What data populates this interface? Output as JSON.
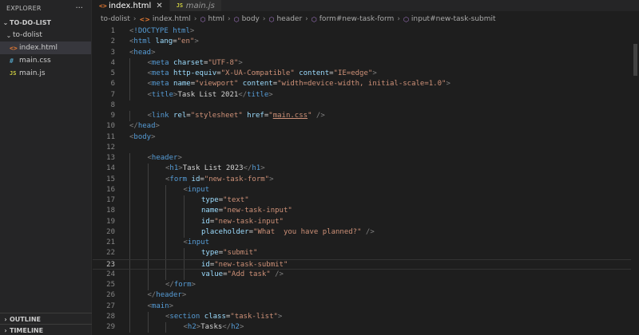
{
  "sidebar": {
    "title": "EXPLORER",
    "more": "···",
    "project": "TO-DO-LIST",
    "folder": "to-dolist",
    "files": [
      {
        "name": "index.html",
        "icon": "<>",
        "type": "html"
      },
      {
        "name": "main.css",
        "icon": "#",
        "type": "css"
      },
      {
        "name": "main.js",
        "icon": "JS",
        "type": "js"
      }
    ],
    "outline": "OUTLINE",
    "timeline": "TIMELINE"
  },
  "tabs": [
    {
      "label": "index.html",
      "icon": "<>",
      "close": "✕"
    },
    {
      "label": "main.js",
      "icon": "JS"
    }
  ],
  "breadcrumb": [
    "to-dolist",
    "index.html",
    "html",
    "body",
    "header",
    "form#new-task-form",
    "input#new-task-submit"
  ],
  "editor": {
    "current_line": "23",
    "lines": [
      {
        "n": "1",
        "indent": 0,
        "tokens": [
          [
            "br",
            "<"
          ],
          [
            "tag",
            "!DOCTYPE"
          ],
          [
            "txt",
            " "
          ],
          [
            "tag",
            "html"
          ],
          [
            "br",
            ">"
          ]
        ]
      },
      {
        "n": "2",
        "indent": 0,
        "tokens": [
          [
            "br",
            "<"
          ],
          [
            "tag",
            "html"
          ],
          [
            "txt",
            " "
          ],
          [
            "attr",
            "lang"
          ],
          [
            "txt",
            "="
          ],
          [
            "str",
            "\"en\""
          ],
          [
            "br",
            ">"
          ]
        ]
      },
      {
        "n": "3",
        "indent": 0,
        "tokens": [
          [
            "br",
            "<"
          ],
          [
            "tag",
            "head"
          ],
          [
            "br",
            ">"
          ]
        ]
      },
      {
        "n": "4",
        "indent": 1,
        "tokens": [
          [
            "br",
            "<"
          ],
          [
            "tag",
            "meta"
          ],
          [
            "txt",
            " "
          ],
          [
            "attr",
            "charset"
          ],
          [
            "txt",
            "="
          ],
          [
            "str",
            "\"UTF-8\""
          ],
          [
            "br",
            ">"
          ]
        ]
      },
      {
        "n": "5",
        "indent": 1,
        "tokens": [
          [
            "br",
            "<"
          ],
          [
            "tag",
            "meta"
          ],
          [
            "txt",
            " "
          ],
          [
            "attr",
            "http-equiv"
          ],
          [
            "txt",
            "="
          ],
          [
            "str",
            "\"X-UA-Compatible\""
          ],
          [
            "txt",
            " "
          ],
          [
            "attr",
            "content"
          ],
          [
            "txt",
            "="
          ],
          [
            "str",
            "\"IE=edge\""
          ],
          [
            "br",
            ">"
          ]
        ]
      },
      {
        "n": "6",
        "indent": 1,
        "tokens": [
          [
            "br",
            "<"
          ],
          [
            "tag",
            "meta"
          ],
          [
            "txt",
            " "
          ],
          [
            "attr",
            "name"
          ],
          [
            "txt",
            "="
          ],
          [
            "str",
            "\"viewport\""
          ],
          [
            "txt",
            " "
          ],
          [
            "attr",
            "content"
          ],
          [
            "txt",
            "="
          ],
          [
            "str",
            "\"width=device-width, initial-scale=1.0\""
          ],
          [
            "br",
            ">"
          ]
        ]
      },
      {
        "n": "7",
        "indent": 1,
        "tokens": [
          [
            "br",
            "<"
          ],
          [
            "tag",
            "title"
          ],
          [
            "br",
            ">"
          ],
          [
            "txt",
            "Task List 2021"
          ],
          [
            "br",
            "</"
          ],
          [
            "tag",
            "title"
          ],
          [
            "br",
            ">"
          ]
        ]
      },
      {
        "n": "8",
        "indent": 0,
        "tokens": []
      },
      {
        "n": "9",
        "indent": 1,
        "tokens": [
          [
            "br",
            "<"
          ],
          [
            "tag",
            "link"
          ],
          [
            "txt",
            " "
          ],
          [
            "attr",
            "rel"
          ],
          [
            "txt",
            "="
          ],
          [
            "str",
            "\"stylesheet\""
          ],
          [
            "txt",
            " "
          ],
          [
            "attr",
            "href"
          ],
          [
            "txt",
            "="
          ],
          [
            "str",
            "\""
          ],
          [
            "link",
            "main.css"
          ],
          [
            "str",
            "\""
          ],
          [
            "txt",
            " "
          ],
          [
            "br",
            "/>"
          ]
        ]
      },
      {
        "n": "10",
        "indent": 0,
        "tokens": [
          [
            "br",
            "</"
          ],
          [
            "tag",
            "head"
          ],
          [
            "br",
            ">"
          ]
        ]
      },
      {
        "n": "11",
        "indent": 0,
        "tokens": [
          [
            "br",
            "<"
          ],
          [
            "tag",
            "body"
          ],
          [
            "br",
            ">"
          ]
        ]
      },
      {
        "n": "12",
        "indent": 0,
        "tokens": []
      },
      {
        "n": "13",
        "indent": 1,
        "tokens": [
          [
            "br",
            "<"
          ],
          [
            "tag",
            "header"
          ],
          [
            "br",
            ">"
          ]
        ]
      },
      {
        "n": "14",
        "indent": 2,
        "tokens": [
          [
            "br",
            "<"
          ],
          [
            "tag",
            "h1"
          ],
          [
            "br",
            ">"
          ],
          [
            "txt",
            "Task List 2023"
          ],
          [
            "br",
            "</"
          ],
          [
            "tag",
            "h1"
          ],
          [
            "br",
            ">"
          ]
        ]
      },
      {
        "n": "15",
        "indent": 2,
        "tokens": [
          [
            "br",
            "<"
          ],
          [
            "tag",
            "form"
          ],
          [
            "txt",
            " "
          ],
          [
            "attr",
            "id"
          ],
          [
            "txt",
            "="
          ],
          [
            "str",
            "\"new-task-form\""
          ],
          [
            "br",
            ">"
          ]
        ]
      },
      {
        "n": "16",
        "indent": 3,
        "tokens": [
          [
            "br",
            "<"
          ],
          [
            "tag",
            "input"
          ]
        ]
      },
      {
        "n": "17",
        "indent": 4,
        "tokens": [
          [
            "attr",
            "type"
          ],
          [
            "txt",
            "="
          ],
          [
            "str",
            "\"text\""
          ]
        ]
      },
      {
        "n": "18",
        "indent": 4,
        "tokens": [
          [
            "attr",
            "name"
          ],
          [
            "txt",
            "="
          ],
          [
            "str",
            "\"new-task-input\""
          ]
        ]
      },
      {
        "n": "19",
        "indent": 4,
        "tokens": [
          [
            "attr",
            "id"
          ],
          [
            "txt",
            "="
          ],
          [
            "str",
            "\"new-task-input\""
          ]
        ]
      },
      {
        "n": "20",
        "indent": 4,
        "tokens": [
          [
            "attr",
            "placeholder"
          ],
          [
            "txt",
            "="
          ],
          [
            "str",
            "\"What  you have planned?\""
          ],
          [
            "txt",
            " "
          ],
          [
            "br",
            "/>"
          ]
        ]
      },
      {
        "n": "21",
        "indent": 3,
        "tokens": [
          [
            "br",
            "<"
          ],
          [
            "tag",
            "input"
          ]
        ]
      },
      {
        "n": "22",
        "indent": 4,
        "tokens": [
          [
            "attr",
            "type"
          ],
          [
            "txt",
            "="
          ],
          [
            "str",
            "\"submit\""
          ]
        ]
      },
      {
        "n": "23",
        "indent": 4,
        "tokens": [
          [
            "attr",
            "id"
          ],
          [
            "txt",
            "="
          ],
          [
            "str",
            "\"new-task-submit\""
          ]
        ]
      },
      {
        "n": "24",
        "indent": 4,
        "tokens": [
          [
            "attr",
            "value"
          ],
          [
            "txt",
            "="
          ],
          [
            "str",
            "\"Add task\""
          ],
          [
            "txt",
            " "
          ],
          [
            "br",
            "/>"
          ]
        ]
      },
      {
        "n": "25",
        "indent": 2,
        "tokens": [
          [
            "br",
            "</"
          ],
          [
            "tag",
            "form"
          ],
          [
            "br",
            ">"
          ]
        ]
      },
      {
        "n": "26",
        "indent": 1,
        "tokens": [
          [
            "br",
            "</"
          ],
          [
            "tag",
            "header"
          ],
          [
            "br",
            ">"
          ]
        ]
      },
      {
        "n": "27",
        "indent": 1,
        "tokens": [
          [
            "br",
            "<"
          ],
          [
            "tag",
            "main"
          ],
          [
            "br",
            ">"
          ]
        ]
      },
      {
        "n": "28",
        "indent": 2,
        "tokens": [
          [
            "br",
            "<"
          ],
          [
            "tag",
            "section"
          ],
          [
            "txt",
            " "
          ],
          [
            "attr",
            "class"
          ],
          [
            "txt",
            "="
          ],
          [
            "str",
            "\"task-list\""
          ],
          [
            "br",
            ">"
          ]
        ]
      },
      {
        "n": "29",
        "indent": 3,
        "tokens": [
          [
            "br",
            "<"
          ],
          [
            "tag",
            "h2"
          ],
          [
            "br",
            ">"
          ],
          [
            "txt",
            "Tasks"
          ],
          [
            "br",
            "</"
          ],
          [
            "tag",
            "h2"
          ],
          [
            "br",
            ">"
          ]
        ]
      }
    ]
  },
  "colors": {
    "tag": "#569cd6",
    "attr": "#9cdcfe",
    "string": "#ce9178",
    "text": "#d4d4d4",
    "bracket": "#808080",
    "background": "#1e1e1e"
  }
}
